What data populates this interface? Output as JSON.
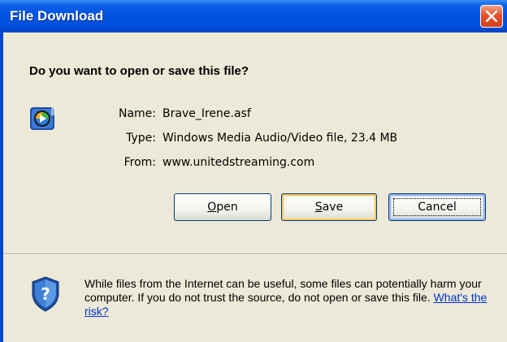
{
  "window": {
    "title": "File Download",
    "close_label": "Close"
  },
  "dialog": {
    "heading": "Do you want to open or save this file?",
    "file_icon": "windows-media-file-icon",
    "fields": [
      {
        "label": "Name:",
        "value": "Brave_Irene.asf"
      },
      {
        "label": "Type:",
        "value": "Windows Media Audio/Video file, 23.4 MB"
      },
      {
        "label": "From:",
        "value": "www.unitedstreaming.com"
      }
    ],
    "buttons": {
      "open": {
        "mnemonic": "O",
        "rest": "pen"
      },
      "save": {
        "mnemonic": "S",
        "rest": "ave"
      },
      "cancel": "Cancel"
    }
  },
  "warning": {
    "icon": "security-shield-icon",
    "text": "While files from the Internet can be useful, some files can potentially harm your computer. If you do not trust the source, do not open or save this file.",
    "link": "What's the risk?"
  },
  "colors": {
    "titlebar": "#0054e3",
    "dialog_bg": "#ece9d8",
    "link": "#0033cc",
    "close_button": "#e6502a"
  }
}
